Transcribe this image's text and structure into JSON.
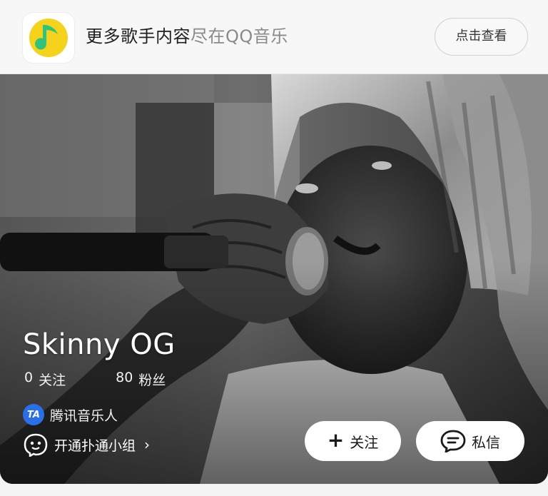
{
  "banner": {
    "text_dark": "更多歌手内容",
    "text_light": "尽在QQ音乐",
    "open_button": "点击查看",
    "app_icon": "qq-music-icon"
  },
  "artist": {
    "name": "Skinny OG",
    "following_count": "0",
    "following_label": "关注",
    "followers_count": "80",
    "followers_label": "粉丝",
    "verification_badge": "TA",
    "verification_label": "腾讯音乐人",
    "group_link": "开通扑通小组"
  },
  "actions": {
    "follow": "关注",
    "message": "私信"
  },
  "colors": {
    "brand_yellow": "#f5d21b",
    "brand_green": "#31c27c",
    "verify_blue": "#2a6fe8"
  }
}
